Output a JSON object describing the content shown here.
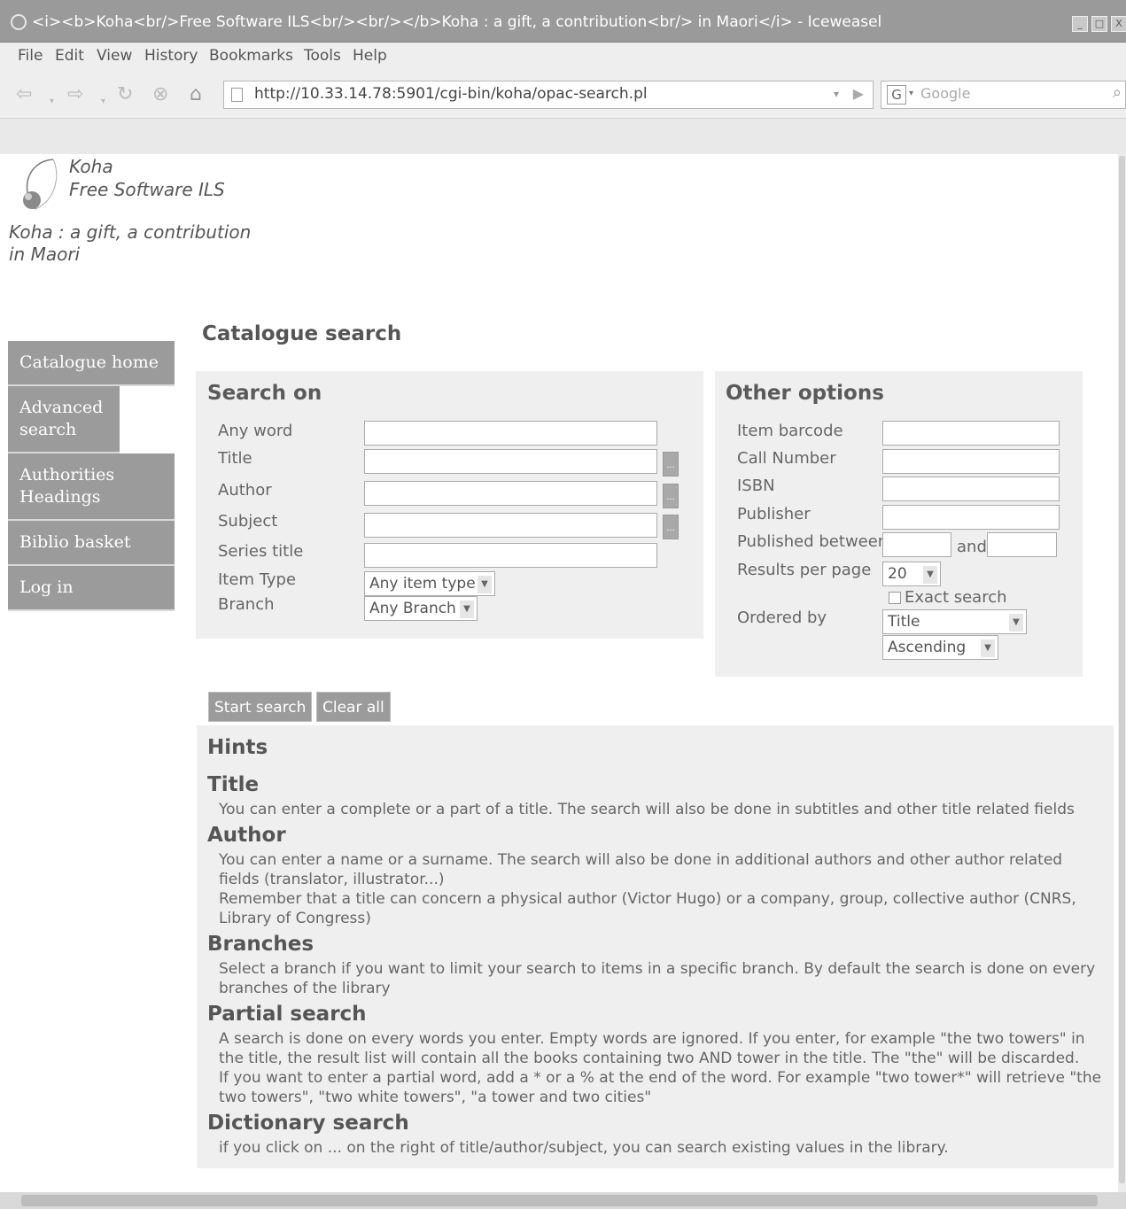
{
  "window": {
    "title": "<i><b>Koha<br/>Free Software ILS<br/><br/></b>Koha : a gift, a contribution<br/> in Maori</i> - Iceweasel",
    "controls": [
      "_",
      "□",
      "X"
    ]
  },
  "menu": [
    "File",
    "Edit",
    "View",
    "History",
    "Bookmarks",
    "Tools",
    "Help"
  ],
  "browser": {
    "url": "http://10.33.14.78:5901/cgi-bin/koha/opac-search.pl",
    "search_placeholder": "Google",
    "search_engine_letter": "G"
  },
  "logo": {
    "line1": "Koha",
    "line2": "Free Software ILS",
    "tagline1": "Koha : a gift, a contribution",
    "tagline2": "in Maori"
  },
  "sidebar": {
    "items": [
      {
        "label": "Catalogue home"
      },
      {
        "label": "Advanced search"
      },
      {
        "label": "Authorities Headings"
      },
      {
        "label": "Biblio basket"
      },
      {
        "label": "Log in"
      }
    ]
  },
  "page": {
    "heading": "Catalogue search"
  },
  "search_on": {
    "title": "Search on",
    "any_word": "Any word",
    "title_label": "Title",
    "author": "Author",
    "subject": "Subject",
    "series_title": "Series title",
    "item_type": "Item Type",
    "item_type_value": "Any item type",
    "branch": "Branch",
    "branch_value": "Any Branch",
    "dict_button": "..."
  },
  "other_options": {
    "title": "Other options",
    "item_barcode": "Item barcode",
    "call_number": "Call Number",
    "isbn": "ISBN",
    "publisher": "Publisher",
    "published_between": "Published between",
    "and": "and",
    "results_per_page": "Results per page",
    "results_value": "20",
    "exact_search": "Exact search",
    "ordered_by": "Ordered by",
    "order_field": "Title",
    "order_direction": "Ascending"
  },
  "buttons": {
    "start": "Start search",
    "clear": "Clear all"
  },
  "hints": {
    "title": "Hints",
    "sections": [
      {
        "heading": "Title",
        "text": [
          "You can enter a complete or a part of a title. The search will also be done in subtitles and other title related fields"
        ]
      },
      {
        "heading": "Author",
        "text": [
          "You can enter a name or a surname. The search will also be done in additional authors and other author related fields (translator, illustrator...)",
          "Remember that a title can concern a physical author (Victor Hugo) or a company, group, collective author (CNRS, Library of Congress)"
        ]
      },
      {
        "heading": "Branches",
        "text": [
          "Select a branch if you want to limit your search to items in a specific branch. By default the search is done on every branches of the library"
        ]
      },
      {
        "heading": "Partial search",
        "text": [
          "A search is done on every words you enter. Empty words are ignored. If you enter, for example \"the two towers\" in the title, the result list will contain all the books containing two AND tower in the title. The \"the\" will be discarded.",
          "If you want to enter a partial word, add a * or a % at the end of the word. For example \"two tower*\" will retrieve \"the two towers\", \"two white towers\", \"a tower and two cities\""
        ]
      },
      {
        "heading": "Dictionary search",
        "text": [
          "if you click on ... on the right of title/author/subject, you can search existing values in the library."
        ]
      }
    ]
  }
}
